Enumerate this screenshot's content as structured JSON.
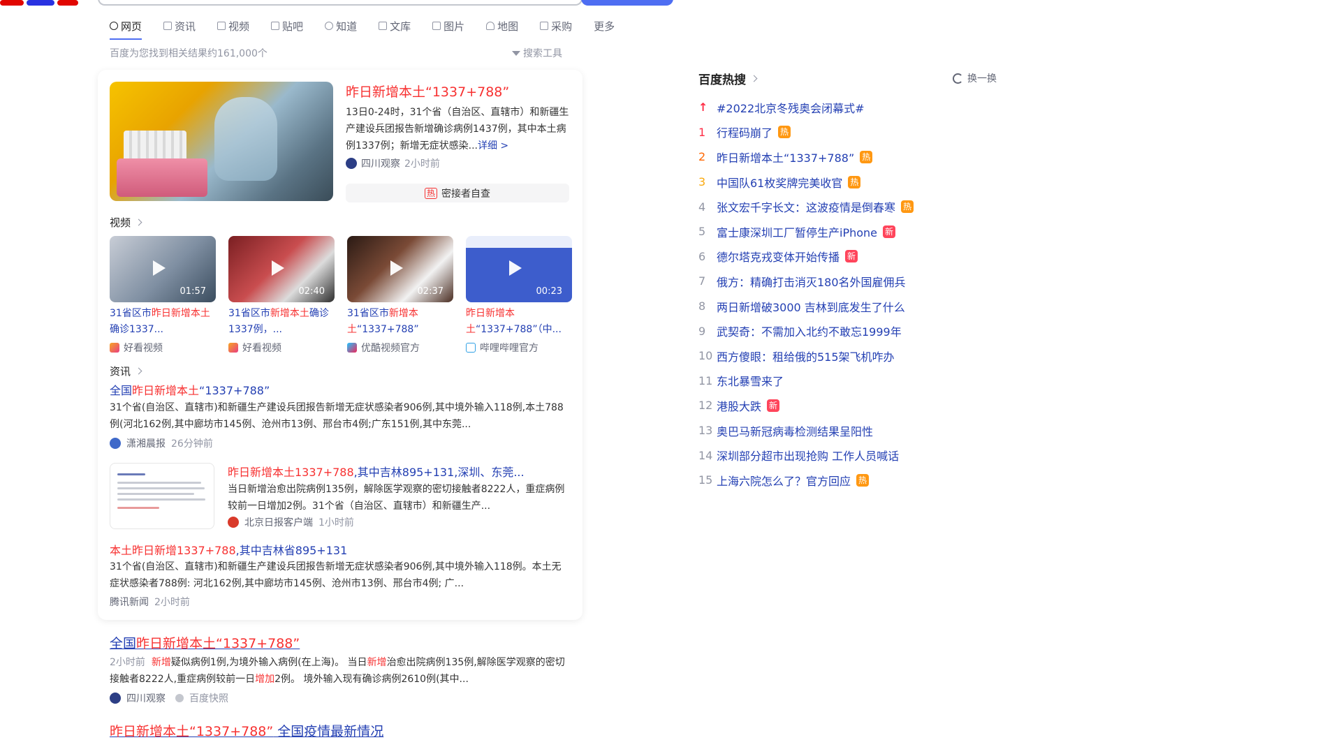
{
  "tabs": [
    {
      "label": "网页",
      "icon": "search-icon",
      "active": true
    },
    {
      "label": "资讯",
      "icon": "news-icon"
    },
    {
      "label": "视频",
      "icon": "video-icon"
    },
    {
      "label": "贴吧",
      "icon": "tieba-icon"
    },
    {
      "label": "知道",
      "icon": "question-icon"
    },
    {
      "label": "文库",
      "icon": "doc-icon"
    },
    {
      "label": "图片",
      "icon": "image-icon"
    },
    {
      "label": "地图",
      "icon": "map-icon"
    },
    {
      "label": "采购",
      "icon": "shop-icon"
    },
    {
      "label": "更多",
      "icon": ""
    }
  ],
  "results_count": "百度为您找到相关结果约161,000个",
  "search_tools": "搜索工具",
  "top_news": {
    "title": "昨日新增本土“1337+788”",
    "desc": "13日0-24时，31个省（自治区、直辖市）和新疆生产建设兵团报告新增确诊病例1437例，其中本土病例1337例；新增无症状感染...",
    "more": "详细 >",
    "source": "四川观察",
    "time": "2小时前",
    "related_tag": "热",
    "related": "密接者自查"
  },
  "video_section": {
    "header": "视频",
    "items": [
      {
        "duration": "01:57",
        "title_pre": "31省区市",
        "title_hl": "昨日新增本土",
        "title_post": "确诊1337...",
        "source": "好看视频"
      },
      {
        "duration": "02:40",
        "title_pre": "31省区市",
        "title_hl": "新增本土",
        "title_post": "确诊1337例，...",
        "source": "好看视频"
      },
      {
        "duration": "02:37",
        "title_pre": "31省区市",
        "title_hl": "新增本土",
        "title_post": "“1337+788”",
        "source": "优酷视频官方"
      },
      {
        "duration": "00:23",
        "title_pre": "",
        "title_hl": "昨日新增本土",
        "title_post": "“1337+788”（中...",
        "source": "哔哩哔哩官方"
      }
    ]
  },
  "news_section": {
    "header": "资讯",
    "items": [
      {
        "title_pre": "全国",
        "title_hl": "昨日新增本土",
        "title_post": "“1337+788”",
        "desc": "31个省(自治区、直辖市)和新疆生产建设兵团报告新增无症状感染者906例,其中境外输入118例,本土788例(河北162例,其中廊坊市145例、沧州市13例、邢台市4例;广东151例,其中东莞...",
        "source": "潇湘晨报",
        "time": "26分钟前"
      },
      {
        "title_pre": "",
        "title_hl": "昨日新增本土1337+788",
        "title_post": ",其中吉林895+131,深圳、东莞...",
        "desc": "当日新增治愈出院病例135例，解除医学观察的密切接触者8222人，重症病例较前一日增加2例。31个省（自治区、直辖市）和新疆生产...",
        "source": "北京日报客户端",
        "time": "1小时前"
      },
      {
        "title_pre": "",
        "title_hl": "本土昨日新增1337+788",
        "title_post": ",其中吉林省895+131",
        "desc": "31个省(自治区、直辖市)和新疆生产建设兵团报告新增无症状感染者906例,其中境外输入118例。本土无症状感染者788例: 河北162例,其中廊坊市145例、沧州市13例、邢台市4例; 广...",
        "source": "腾讯新闻",
        "time": "2小时前"
      }
    ]
  },
  "organic_results": [
    {
      "title_pre": "全国",
      "title_hl": "昨日新增本土“1337+788”",
      "title_post": "",
      "desc_time": "2小时前",
      "desc_hl1": "新增",
      "desc_part1": "疑似病例1例,为境外输入病例(在上海)。 当日",
      "desc_hl2": "新增",
      "desc_part2": "治愈出院病例135例,解除医学观察的密切接触者8222人,重症病例较前一日",
      "desc_hl3": "增加",
      "desc_part3": "2例。 境外输入现有确诊病例2610例(其中...",
      "source": "四川观察",
      "snapshot": "百度快照"
    },
    {
      "title_pre": "",
      "title_hl": "昨日新增本土“1337+788”",
      "title_post": " 全国疫情最新情况"
    }
  ],
  "hot_search": {
    "title": "百度热搜",
    "refresh": "换一换",
    "items": [
      {
        "rank": "↑",
        "title": "#2022北京冬残奥会闭幕式#",
        "badge": ""
      },
      {
        "rank": "1",
        "title": "行程码崩了",
        "badge": "热"
      },
      {
        "rank": "2",
        "title": "昨日新增本土“1337+788”",
        "badge": "热"
      },
      {
        "rank": "3",
        "title": "中国队61枚奖牌完美收官",
        "badge": "热"
      },
      {
        "rank": "4",
        "title": "张文宏千字长文：这波疫情是倒春寒",
        "badge": "热"
      },
      {
        "rank": "5",
        "title": "富士康深圳工厂暂停生产iPhone",
        "badge": "新"
      },
      {
        "rank": "6",
        "title": "德尔塔克戎变体开始传播",
        "badge": "新"
      },
      {
        "rank": "7",
        "title": "俄方：精确打击消灭180名外国雇佣兵",
        "badge": ""
      },
      {
        "rank": "8",
        "title": "两日新增破3000 吉林到底发生了什么",
        "badge": ""
      },
      {
        "rank": "9",
        "title": "武契奇：不需加入北约不敢忘1999年",
        "badge": ""
      },
      {
        "rank": "10",
        "title": "西方傻眼：租给俄的515架飞机咋办",
        "badge": ""
      },
      {
        "rank": "11",
        "title": "东北暴雪来了",
        "badge": ""
      },
      {
        "rank": "12",
        "title": "港股大跌",
        "badge": "新"
      },
      {
        "rank": "13",
        "title": "奥巴马新冠病毒检测结果呈阳性",
        "badge": ""
      },
      {
        "rank": "14",
        "title": "深圳部分超市出现抢购 工作人员喊话",
        "badge": ""
      },
      {
        "rank": "15",
        "title": "上海六院怎么了？官方回应",
        "badge": "热"
      }
    ]
  },
  "colors": {
    "link": "#2440b3",
    "highlight": "#f73131",
    "accent": "#4e6ef2",
    "hot_badge": "#ff9812",
    "new_badge": "#ff455b"
  }
}
